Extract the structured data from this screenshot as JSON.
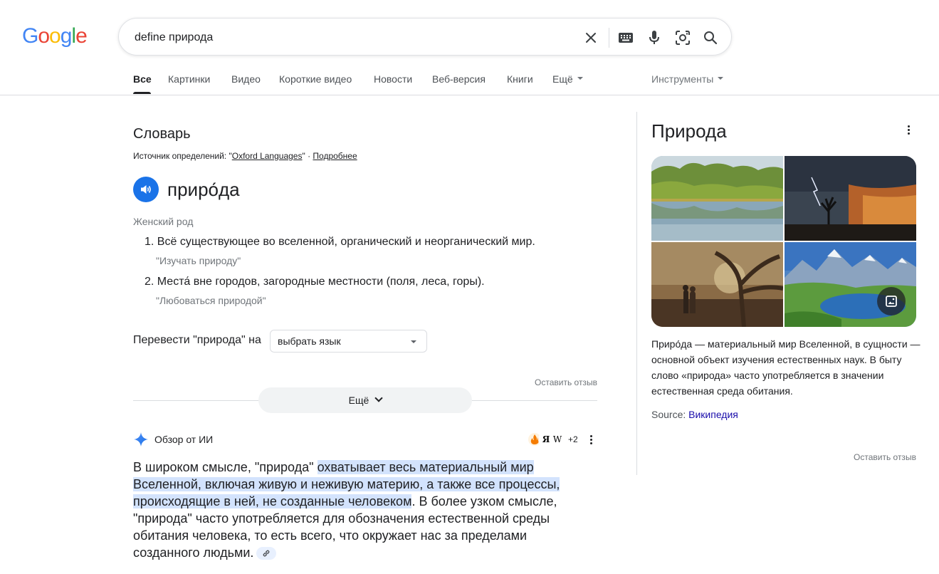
{
  "logo": {
    "text": "Google",
    "letters": [
      "G",
      "o",
      "o",
      "g",
      "l",
      "e"
    ],
    "colors": [
      "#4285f4",
      "#ea4335",
      "#fbbc05",
      "#4285f4",
      "#34a853",
      "#ea4335"
    ]
  },
  "search": {
    "value": "define природа"
  },
  "tabs": [
    {
      "label": "Все",
      "active": true
    },
    {
      "label": "Картинки"
    },
    {
      "label": "Видео"
    },
    {
      "label": "Короткие видео"
    },
    {
      "label": "Новости"
    },
    {
      "label": "Веб-версия"
    },
    {
      "label": "Книги"
    },
    {
      "label": "Ещё"
    }
  ],
  "tools_label": "Инструменты",
  "dictionary": {
    "title": "Словарь",
    "source_prefix": "Источник определений: \"",
    "source_name": "Oxford Languages",
    "source_suffix": "\" · ",
    "more_link": "Подробнее",
    "word": "приро́да",
    "gender": "Женский род",
    "definitions": [
      {
        "number": "1.",
        "text": "Всё существующее во вселенной, органический и неорганический мир.",
        "example": "\"Изучать природу\""
      },
      {
        "number": "2.",
        "text": "Места́ вне городов, загородные местности (поля, леса, горы).",
        "example": "\"Любоваться природой\""
      }
    ],
    "translate_label": "Перевести \"природа\" на",
    "language_select": "выбрать язык",
    "feedback": "Оставить отзыв",
    "more_button": "Ещё"
  },
  "ai_overview": {
    "title": "Обзор от ИИ",
    "source_count": "+2",
    "text_before": "В широком смысле, \"природа\" ",
    "text_highlight": "охватывает весь материальный мир Вселенной, включая живую и неживую материю, а также все процессы, происходящие в ней, не созданные человеком",
    "text_after": ". В более узком смысле, \"природа\" часто употребляется для обозначения естественной среды обитания человека, то есть всего, что окружает нас за пределами созданного людьми."
  },
  "knowledge_panel": {
    "title": "Природа",
    "description": "Приро́да — материальный мир Вселенной, в сущности — основной объект изучения естественных наук. В быту слово «природа» часто употребляется в значении естественная среда обитания.",
    "source_label": "Source: ",
    "source_link": "Википедия",
    "feedback": "Оставить отзыв"
  },
  "colors": {
    "accent": "#1a73e8",
    "link": "#1a0dab",
    "highlight": "#d3e3fd"
  },
  "icons": [
    "clear-icon",
    "keyboard-icon",
    "microphone-icon",
    "lens-icon",
    "search-icon",
    "speaker-icon",
    "sparkle-icon",
    "image-icon",
    "more-vert-icon",
    "link-icon"
  ]
}
